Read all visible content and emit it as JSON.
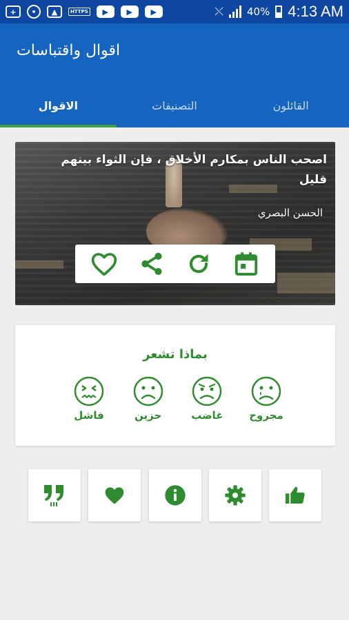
{
  "status_bar": {
    "https_label": "HTTPS",
    "battery": "40%",
    "time": "4:13 AM"
  },
  "app_bar": {
    "title": "اقوال واقتباسات"
  },
  "tabs": [
    {
      "label": "الاقوال",
      "active": true
    },
    {
      "label": "التصنيفات",
      "active": false
    },
    {
      "label": "القائلون",
      "active": false
    }
  ],
  "quote": {
    "text": "اصحب الناس بمكارم الأخلاق ، فإن الثواء بينهم قليل",
    "author": "الحسن البصري",
    "actions": [
      "heart-outline-icon",
      "share-icon",
      "refresh-icon",
      "calendar-icon"
    ]
  },
  "mood": {
    "title": "بماذا تشعر",
    "items": [
      {
        "label": "فاشل",
        "icon": "face-failed-icon"
      },
      {
        "label": "حزين",
        "icon": "face-sad-icon"
      },
      {
        "label": "غاضب",
        "icon": "face-angry-icon"
      },
      {
        "label": "مجروح",
        "icon": "face-hurt-icon"
      }
    ]
  },
  "bottom_buttons": [
    "quote-icon",
    "heart-icon",
    "info-icon",
    "gear-icon",
    "thumbs-up-icon"
  ],
  "colors": {
    "status_bar": "#0d47a1",
    "app_bar": "#1565c0",
    "accent_green": "#2e8b2e",
    "tab_indicator": "#43a047",
    "background": "#eeeeee"
  }
}
